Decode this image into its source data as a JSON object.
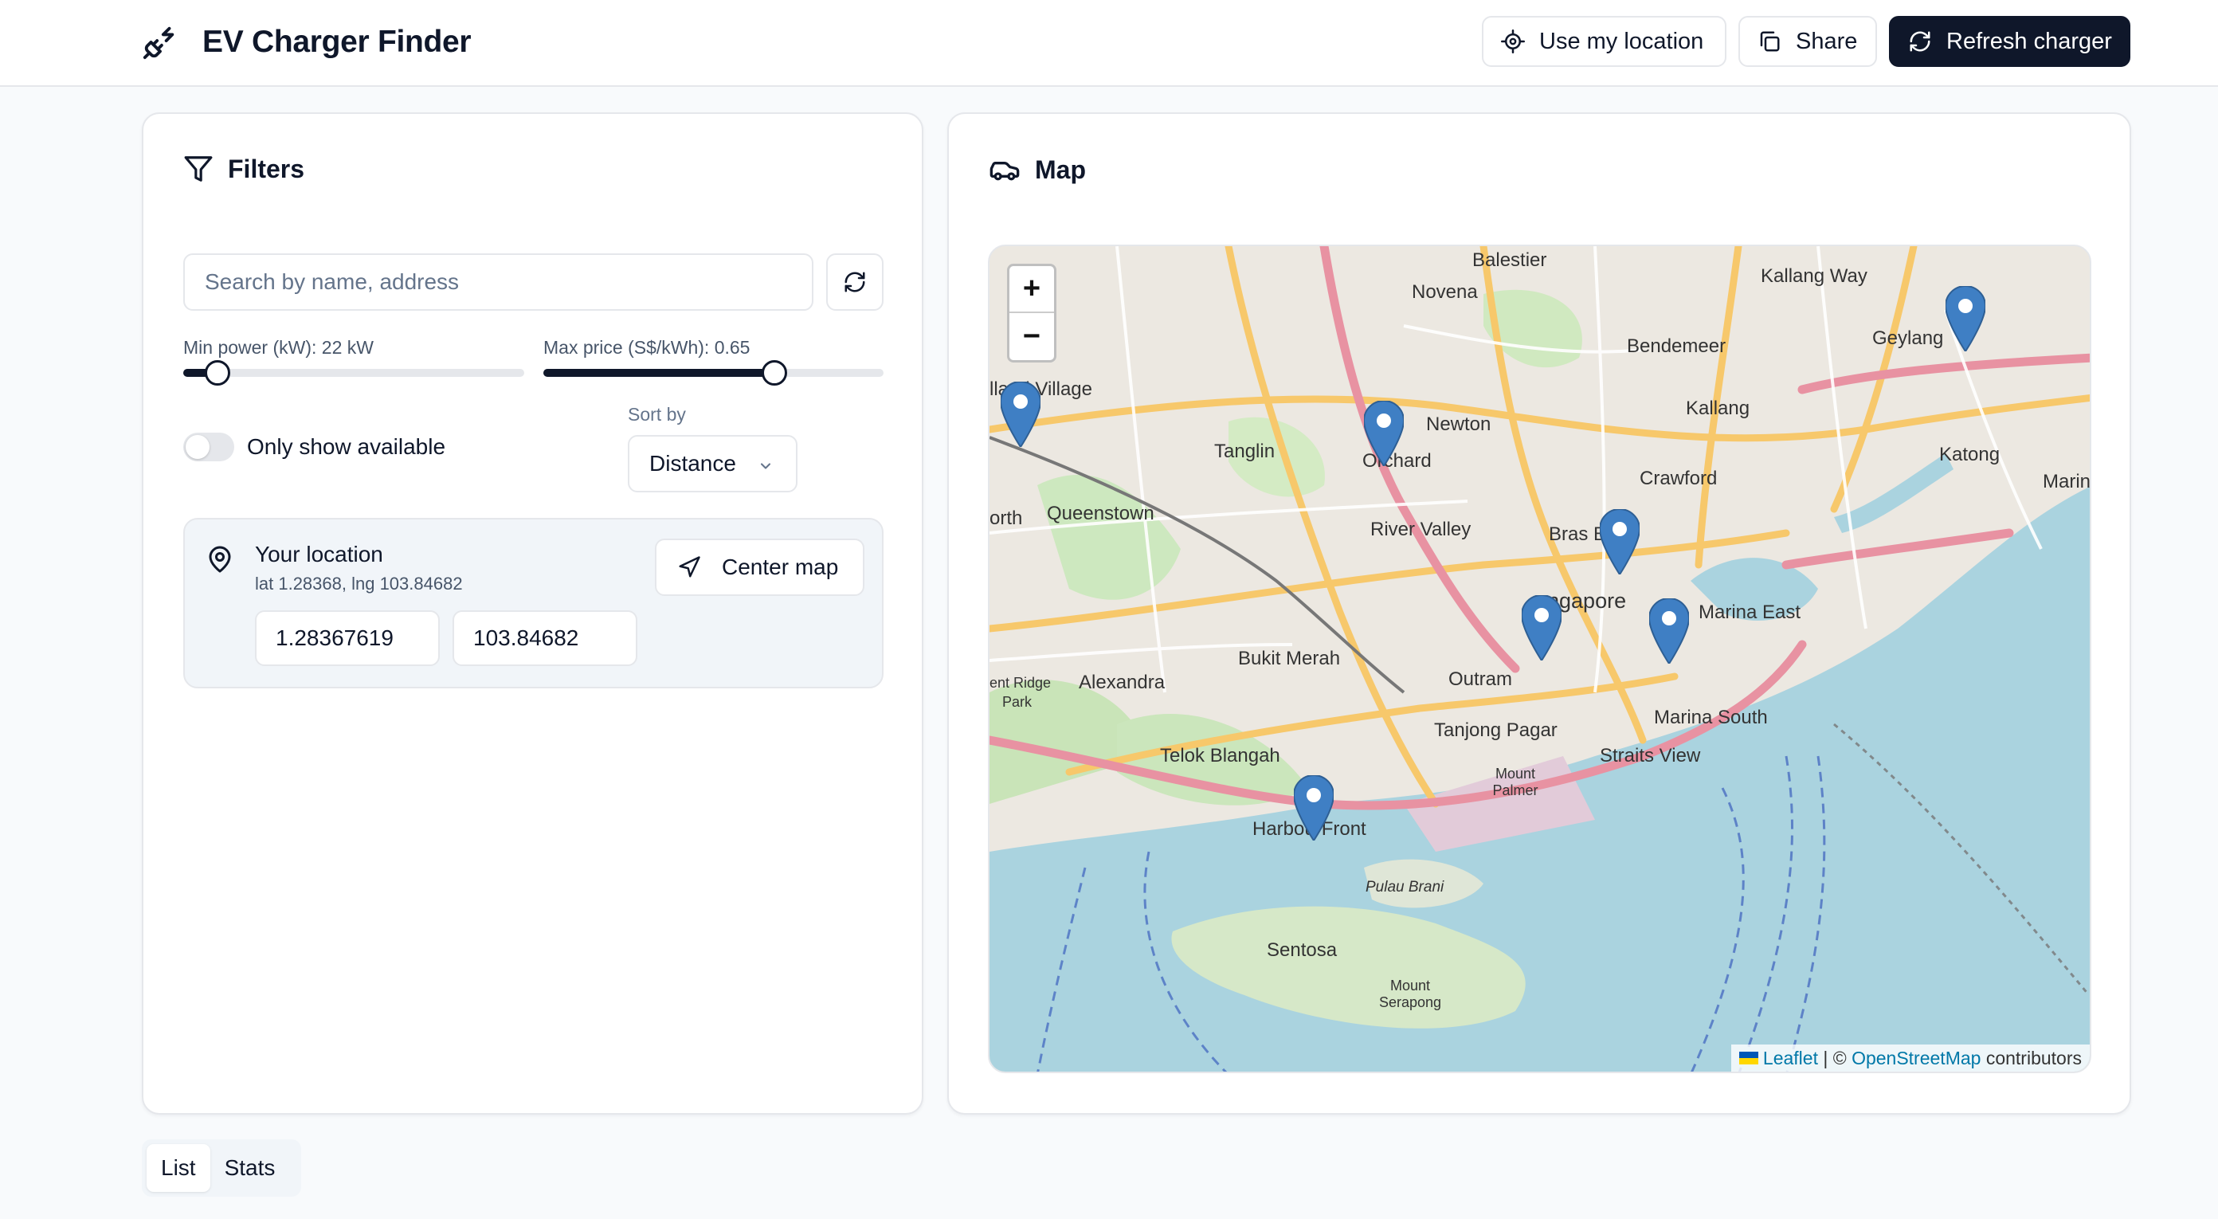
{
  "app": {
    "title": "EV Charger Finder"
  },
  "header": {
    "use_location_label": "Use my location",
    "share_label": "Share",
    "refresh_label": "Refresh charger"
  },
  "filters": {
    "title": "Filters",
    "search_placeholder": "Search by name, address",
    "min_power_label": "Min power (kW): 22 kW",
    "min_power_value": 22,
    "min_power_fraction": 0.1,
    "max_price_label": "Max price (S$/kWh): 0.65",
    "max_price_value": 0.65,
    "max_price_fraction": 0.68,
    "only_available_label": "Only show available",
    "only_available": false,
    "sort_by_label": "Sort by",
    "sort_by_value": "Distance"
  },
  "location": {
    "title": "Your location",
    "subtitle": "lat 1.28368, lng 103.84682",
    "center_map_label": "Center map",
    "lat_value": "1.28367619",
    "lng_value": "103.84682"
  },
  "map": {
    "title": "Map",
    "zoom_in": "+",
    "zoom_out": "−",
    "attribution_leaflet": "Leaflet",
    "attribution_sep": " | © ",
    "attribution_osm": "OpenStreetMap",
    "attribution_tail": " contributors",
    "place_labels": {
      "balestier": "Balestier",
      "novena": "Novena",
      "kallang_way": "Kallang Way",
      "geylang": "Geylang",
      "bendemeer": "Bendemeer",
      "holland_village": "lland Village",
      "newton": "Newton",
      "kallang": "Kallang",
      "tanglin": "Tanglin",
      "orchard": "Orchard",
      "katong": "Katong",
      "marine": "Marin",
      "crawford": "Crawford",
      "queenstown": "Queenstown",
      "north": "orth",
      "river_valley": "River Valley",
      "bras_basah": "Bras Bas",
      "singapore": "ngapore",
      "marina_east": "Marina East",
      "bukit_merah": "Bukit Merah",
      "alexandra": "Alexandra",
      "outram": "Outram",
      "ent_ridge": "ent Ridge",
      "park": "Park",
      "marina_south": "Marina South",
      "tanjong_pagar": "Tanjong Pagar",
      "telok_blangah": "Telok Blangah",
      "straits_view": "Straits View",
      "mount_palmer": "Mount Palmer",
      "harbourfront": "HarbourFront",
      "pulau_brani": "Pulau Brani",
      "sentosa": "Sentosa",
      "mount_serapong": "Mount Serapong"
    }
  },
  "tabs": [
    {
      "label": "List",
      "active": true
    },
    {
      "label": "Stats",
      "active": false
    }
  ],
  "colors": {
    "primary": "#0f172a",
    "marker": "#3f7fc4",
    "water": "#aad3df",
    "road_major": "#f7c86b",
    "road_primary": "#e892a2"
  }
}
